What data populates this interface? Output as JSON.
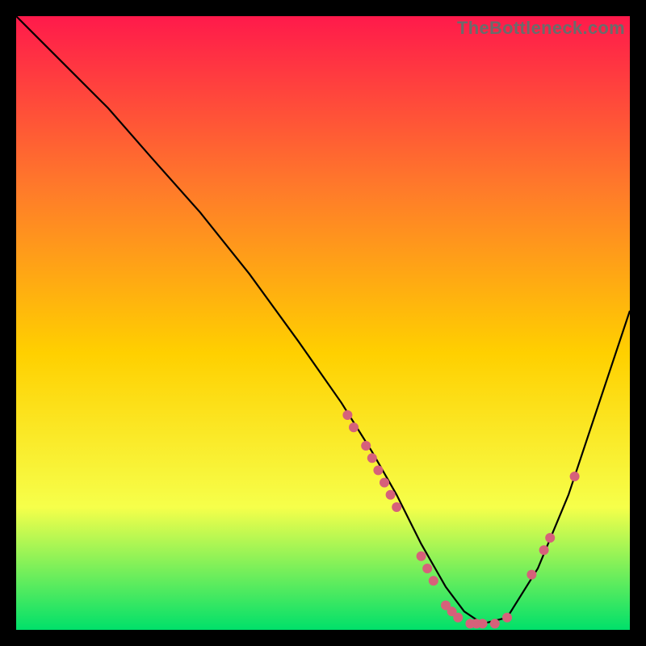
{
  "watermark": "TheBottleneck.com",
  "chart_data": {
    "type": "line",
    "title": "",
    "xlabel": "",
    "ylabel": "",
    "xlim": [
      0,
      100
    ],
    "ylim": [
      0,
      100
    ],
    "grid": false,
    "legend": false,
    "background_gradient": {
      "top": "#ff1a4b",
      "upper_mid": "#ff7a2a",
      "mid": "#ffd000",
      "lower_mid": "#f6ff4a",
      "bottom": "#00e06a"
    },
    "series": [
      {
        "name": "bottleneck-curve",
        "color": "#000000",
        "x": [
          0,
          3,
          8,
          15,
          22,
          30,
          38,
          46,
          53,
          58,
          62,
          66,
          70,
          73,
          76,
          80,
          85,
          90,
          95,
          100
        ],
        "y": [
          100,
          97,
          92,
          85,
          77,
          68,
          58,
          47,
          37,
          29,
          22,
          14,
          7,
          3,
          1,
          2,
          10,
          22,
          37,
          52
        ]
      }
    ],
    "markers": {
      "name": "highlighted-points",
      "color": "#d6617a",
      "points": [
        {
          "x": 54,
          "y": 35
        },
        {
          "x": 55,
          "y": 33
        },
        {
          "x": 57,
          "y": 30
        },
        {
          "x": 58,
          "y": 28
        },
        {
          "x": 59,
          "y": 26
        },
        {
          "x": 60,
          "y": 24
        },
        {
          "x": 61,
          "y": 22
        },
        {
          "x": 62,
          "y": 20
        },
        {
          "x": 66,
          "y": 12
        },
        {
          "x": 67,
          "y": 10
        },
        {
          "x": 68,
          "y": 8
        },
        {
          "x": 70,
          "y": 4
        },
        {
          "x": 71,
          "y": 3
        },
        {
          "x": 72,
          "y": 2
        },
        {
          "x": 74,
          "y": 1
        },
        {
          "x": 75,
          "y": 1
        },
        {
          "x": 76,
          "y": 1
        },
        {
          "x": 78,
          "y": 1
        },
        {
          "x": 80,
          "y": 2
        },
        {
          "x": 84,
          "y": 9
        },
        {
          "x": 86,
          "y": 13
        },
        {
          "x": 87,
          "y": 15
        },
        {
          "x": 91,
          "y": 25
        }
      ]
    }
  }
}
